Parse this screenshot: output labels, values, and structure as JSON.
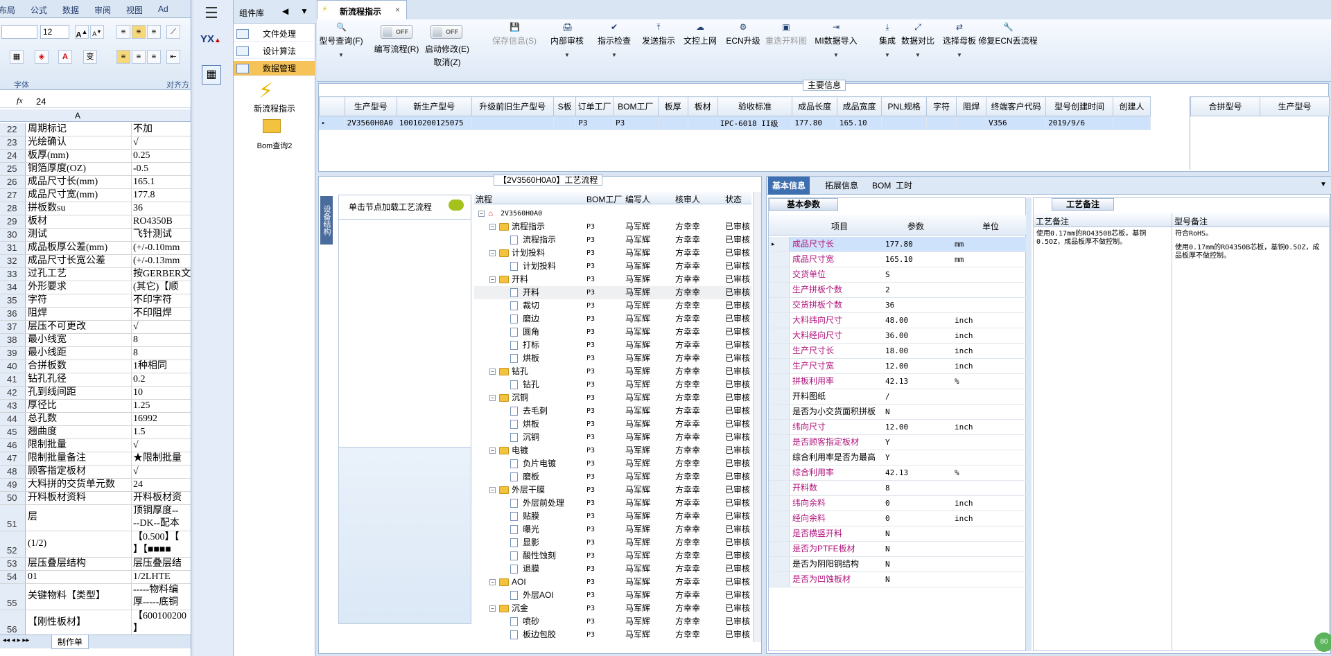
{
  "excel": {
    "tabs": [
      "布局",
      "公式",
      "数据",
      "审阅",
      "视图",
      "Ad"
    ],
    "font_size": "12",
    "group_font": "字体",
    "group_align": "对齐方",
    "cell_ref": "",
    "formula_value": "24",
    "col_a": "A",
    "rows": [
      {
        "n": "22",
        "a": "周期标记",
        "b": "不加"
      },
      {
        "n": "23",
        "a": "光绘确认",
        "b": "√"
      },
      {
        "n": "24",
        "a": "板厚(mm)",
        "b": "0.25"
      },
      {
        "n": "25",
        "a": "铜箔厚度(OZ)",
        "b": "-0.5"
      },
      {
        "n": "26",
        "a": "成品尺寸长(mm)",
        "b": "165.1"
      },
      {
        "n": "27",
        "a": "成品尺寸宽(mm)",
        "b": "177.8"
      },
      {
        "n": "28",
        "a": "拼板数su",
        "b": "36"
      },
      {
        "n": "29",
        "a": "板材",
        "b": "RO4350B"
      },
      {
        "n": "30",
        "a": "测试",
        "b": "飞针测试"
      },
      {
        "n": "31",
        "a": "成品板厚公差(mm)",
        "b": "(+/-0.10mm"
      },
      {
        "n": "32",
        "a": "成品尺寸长宽公差",
        "b": "(+/-0.13mm"
      },
      {
        "n": "33",
        "a": "过孔工艺",
        "b": "按GERBER文"
      },
      {
        "n": "34",
        "a": "外形要求",
        "b": "(其它)【顺"
      },
      {
        "n": "35",
        "a": "字符",
        "b": "不印字符"
      },
      {
        "n": "36",
        "a": "阻焊",
        "b": "不印阻焊"
      },
      {
        "n": "37",
        "a": "层压不可更改",
        "b": "√"
      },
      {
        "n": "38",
        "a": "最小线宽",
        "b": "8"
      },
      {
        "n": "39",
        "a": "最小线距",
        "b": "8"
      },
      {
        "n": "40",
        "a": "合拼板数",
        "b": "1种相同"
      },
      {
        "n": "41",
        "a": "钻孔孔径",
        "b": "0.2"
      },
      {
        "n": "42",
        "a": "孔到线间距",
        "b": "10"
      },
      {
        "n": "43",
        "a": "厚径比",
        "b": "1.25"
      },
      {
        "n": "44",
        "a": "总孔数",
        "b": "16992"
      },
      {
        "n": "45",
        "a": "翘曲度",
        "b": "1.5"
      },
      {
        "n": "46",
        "a": "限制批量",
        "b": "√"
      },
      {
        "n": "47",
        "a": "限制批量备注",
        "b": "★限制批量"
      },
      {
        "n": "48",
        "a": "顾客指定板材",
        "b": "√"
      },
      {
        "n": "49",
        "a": "大料拼的交货单元数",
        "b": "24"
      },
      {
        "n": "50",
        "a": "开料板材资料",
        "b": "开料板材资"
      }
    ],
    "tall_rows": [
      {
        "n": "51",
        "a": "层",
        "b": "顶铜厚度--",
        "b2": "--DK--配本"
      },
      {
        "n": "52",
        "a": "(1/2)",
        "b": "【0.500】【",
        "b2": "】【■■■■"
      },
      {
        "n": "53",
        "a": "层压叠层结构",
        "b": "层压叠层结"
      },
      {
        "n": "54",
        "a": "01",
        "b": "1/2LHTE"
      },
      {
        "n": "55",
        "a": "关键物料【类型】",
        "b": "-----物料编",
        "b2": "厚-----底铜"
      },
      {
        "n": "56",
        "a": "【刚性板材】",
        "b": "【600100200",
        "b2": "】"
      }
    ],
    "sheet_tab": "制作单"
  },
  "left": {
    "title": "组件库",
    "items": [
      "文件处理",
      "设计算法",
      "数据管理"
    ],
    "icons": [
      "新流程指示",
      "Bom查询2"
    ],
    "logo": "YX"
  },
  "main": {
    "doc_tab": "新流程指示",
    "toolbar": [
      {
        "label": "型号查询(F)",
        "icon": "🔍",
        "drop": true
      },
      {
        "label": "编写流程(R)",
        "toggle": "OFF"
      },
      {
        "label": "启动修改(E)",
        "toggle": "OFF",
        "extra": "取消(Z)"
      },
      {
        "label": "保存信息(S)",
        "icon": "💾",
        "dis": true
      },
      {
        "label": "内部审核",
        "icon": "🖨",
        "drop": true
      },
      {
        "label": "指示检查",
        "icon": "✔",
        "drop": true
      },
      {
        "label": "发送指示",
        "icon": "⤒"
      },
      {
        "label": "文控上网",
        "icon": "☁"
      },
      {
        "label": "ECN升级",
        "icon": "⚙"
      },
      {
        "label": "重迭开料图",
        "icon": "▣",
        "dis": true
      },
      {
        "label": "MI数据导入",
        "icon": "⇥",
        "drop": true
      },
      {
        "label": "集成",
        "icon": "⤓",
        "drop": true
      },
      {
        "label": "数据对比",
        "icon": "⤢",
        "drop": true
      },
      {
        "label": "选择母板",
        "icon": "⇄",
        "drop": true
      },
      {
        "label": "修复ECN丢流程",
        "icon": "🔧"
      }
    ],
    "main_info_title": "主要信息",
    "main_cols": [
      "生产型号",
      "新生产型号",
      "升级前旧生产型号",
      "S板",
      "订单工厂",
      "BOM工厂",
      "板厚",
      "板材",
      "验收标准",
      "成品长度",
      "成品宽度",
      "PNL规格",
      "字符",
      "阻焊",
      "终端客户代码",
      "型号创建时间",
      "创建人"
    ],
    "main_row": [
      "2V3560H0A0",
      "10010200125075",
      "",
      "",
      "P3",
      "P3",
      "",
      "",
      "IPC-6018 II级",
      "177.80",
      "165.10",
      "",
      "",
      "",
      "V356",
      "2019/9/6",
      ""
    ],
    "merge_cols": [
      "合拼型号",
      "生产型号"
    ],
    "flow_title": "【2V3560H0A0】工艺流程",
    "flow_side": "设备结构",
    "flow_hint": "单击节点加载工艺流程",
    "flow_cols": [
      "流程",
      "BOM工厂",
      "编写人",
      "核审人",
      "状态"
    ],
    "tree": [
      {
        "lvl": 0,
        "t": "2V3560H0A0",
        "root": true
      },
      {
        "lvl": 1,
        "t": "流程指示",
        "folder": true
      },
      {
        "lvl": 2,
        "t": "流程指示"
      },
      {
        "lvl": 1,
        "t": "计划投料",
        "folder": true
      },
      {
        "lvl": 2,
        "t": "计划投料"
      },
      {
        "lvl": 1,
        "t": "开料",
        "folder": true
      },
      {
        "lvl": 2,
        "t": "开料",
        "hl": true
      },
      {
        "lvl": 2,
        "t": "裁切"
      },
      {
        "lvl": 2,
        "t": "磨边"
      },
      {
        "lvl": 2,
        "t": "圆角"
      },
      {
        "lvl": 2,
        "t": "打标"
      },
      {
        "lvl": 2,
        "t": "烘板"
      },
      {
        "lvl": 1,
        "t": "钻孔",
        "folder": true
      },
      {
        "lvl": 2,
        "t": "钻孔"
      },
      {
        "lvl": 1,
        "t": "沉铜",
        "folder": true
      },
      {
        "lvl": 2,
        "t": "去毛刺"
      },
      {
        "lvl": 2,
        "t": "烘板"
      },
      {
        "lvl": 2,
        "t": "沉铜"
      },
      {
        "lvl": 1,
        "t": "电镀",
        "folder": true
      },
      {
        "lvl": 2,
        "t": "负片电镀"
      },
      {
        "lvl": 2,
        "t": "磨板"
      },
      {
        "lvl": 1,
        "t": "外层干膜",
        "folder": true
      },
      {
        "lvl": 2,
        "t": "外层前处理"
      },
      {
        "lvl": 2,
        "t": "贴膜"
      },
      {
        "lvl": 2,
        "t": "曝光"
      },
      {
        "lvl": 2,
        "t": "显影"
      },
      {
        "lvl": 2,
        "t": "酸性蚀刻"
      },
      {
        "lvl": 2,
        "t": "退膜"
      },
      {
        "lvl": 1,
        "t": "AOI",
        "folder": true
      },
      {
        "lvl": 2,
        "t": "外层AOI"
      },
      {
        "lvl": 1,
        "t": "沉金",
        "folder": true
      },
      {
        "lvl": 2,
        "t": "喷砂"
      },
      {
        "lvl": 2,
        "t": "板边包胶"
      }
    ],
    "tree_values": {
      "bom": "P3",
      "writer": "马军辉",
      "reviewer": "方幸幸",
      "status": "已审核"
    },
    "right_tabs": [
      "基本信息",
      "拓展信息",
      "BOM",
      "工时"
    ],
    "param_tab": "基本参数",
    "param_cols": [
      "项目",
      "参数",
      "单位"
    ],
    "params": [
      {
        "i": "成品尺寸长",
        "v": "177.80",
        "u": "mm",
        "alt": true
      },
      {
        "i": "成品尺寸宽",
        "v": "165.10",
        "u": "mm",
        "alt": true
      },
      {
        "i": "交货单位",
        "v": "S",
        "u": "",
        "alt": true
      },
      {
        "i": "生产拼板个数",
        "v": "2",
        "u": "",
        "alt": true
      },
      {
        "i": "交货拼板个数",
        "v": "36",
        "u": "",
        "alt": true
      },
      {
        "i": "大料纬向尺寸",
        "v": "48.00",
        "u": "inch",
        "alt": true
      },
      {
        "i": "大料经向尺寸",
        "v": "36.00",
        "u": "inch",
        "alt": true
      },
      {
        "i": "生产尺寸长",
        "v": "18.00",
        "u": "inch",
        "alt": true
      },
      {
        "i": "生产尺寸宽",
        "v": "12.00",
        "u": "inch",
        "alt": true
      },
      {
        "i": "拼板利用率",
        "v": "42.13",
        "u": "%",
        "alt": true
      },
      {
        "i": "开料图纸",
        "v": "/",
        "u": "",
        "alt": false
      },
      {
        "i": "是否为小交货面积拼板",
        "v": "N",
        "u": "",
        "alt": false
      },
      {
        "i": "纬向尺寸",
        "v": "12.00",
        "u": "inch",
        "alt": true
      },
      {
        "i": "是否顾客指定板材",
        "v": "Y",
        "u": "",
        "alt": true
      },
      {
        "i": "综合利用率是否为最高",
        "v": "Y",
        "u": "",
        "alt": false
      },
      {
        "i": "综合利用率",
        "v": "42.13",
        "u": "%",
        "alt": true
      },
      {
        "i": "开料数",
        "v": "8",
        "u": "",
        "alt": true
      },
      {
        "i": "纬向余料",
        "v": "0",
        "u": "inch",
        "alt": true
      },
      {
        "i": "经向余料",
        "v": "0",
        "u": "inch",
        "alt": true
      },
      {
        "i": "是否横竖开料",
        "v": "N",
        "u": "",
        "alt": true
      },
      {
        "i": "是否为PTFE板材",
        "v": "N",
        "u": "",
        "alt": true
      },
      {
        "i": "是否为阴阳铜结构",
        "v": "N",
        "u": "",
        "alt": false
      },
      {
        "i": "是否为凹蚀板材",
        "v": "N",
        "u": "",
        "alt": true
      }
    ],
    "craft_tab": "工艺备注",
    "craft_cols": [
      "工艺备注",
      "型号备注"
    ],
    "craft_note": "使用0.17mm的RO4350B芯板，基铜0.5OZ，成品板厚不做控制。",
    "model_note1": "符合RoHS。",
    "model_note2": "使用0.17mm的RO4350B芯板，基铜0.5OZ，成品板厚不做控制。",
    "badge": "80"
  }
}
